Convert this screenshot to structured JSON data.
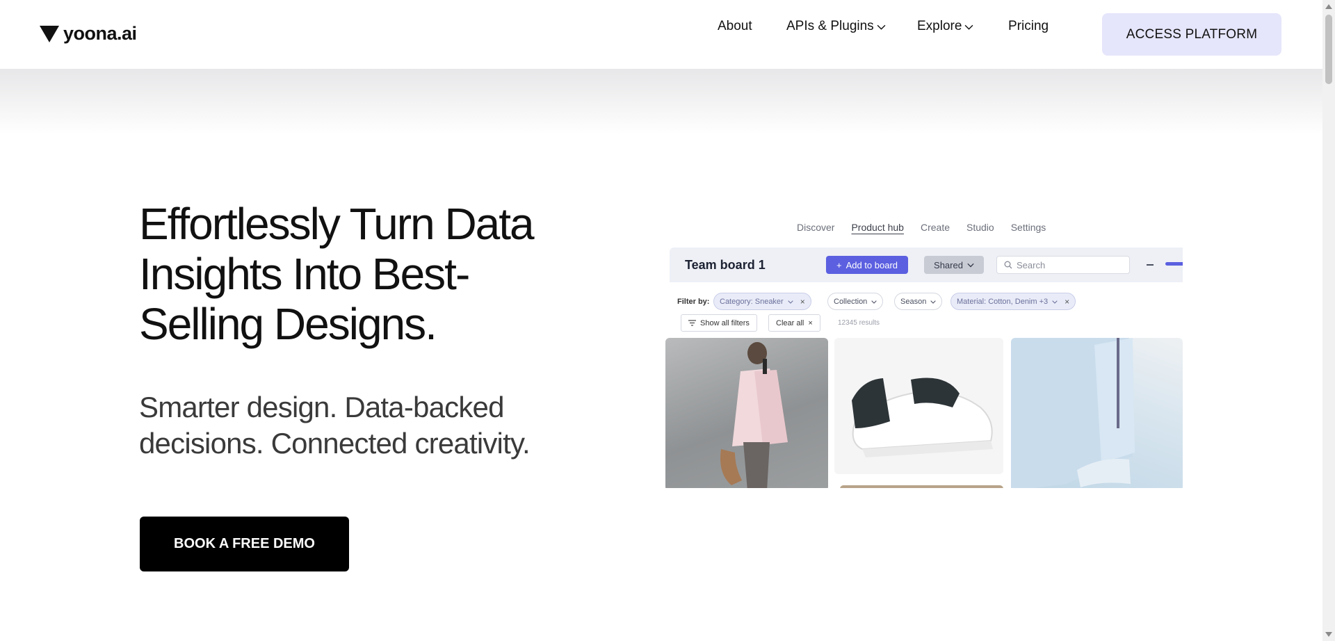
{
  "brand": {
    "name": "yoona.ai"
  },
  "nav": {
    "items": [
      {
        "label": "About"
      },
      {
        "label": "APIs & Plugins"
      },
      {
        "label": "Explore"
      },
      {
        "label": "Pricing"
      }
    ],
    "cta_label": "ACCESS PLATFORM"
  },
  "hero": {
    "headline": "Effortlessly Turn Data Insights Into Best-Selling Designs.",
    "subline": "Smarter design. Data-backed decisions. Connected creativity.",
    "cta_label": "BOOK A FREE DEMO"
  },
  "mockup": {
    "tabs": [
      {
        "label": "Discover"
      },
      {
        "label": "Product hub"
      },
      {
        "label": "Create"
      },
      {
        "label": "Studio"
      },
      {
        "label": "Settings"
      }
    ],
    "board_title": "Team board 1",
    "add_to_board_label": "Add to board",
    "shared_label": "Shared",
    "search_placeholder": "Search",
    "filter_label": "Filter by:",
    "filters": [
      {
        "label": "Category: Sneaker"
      },
      {
        "label": "Collection"
      },
      {
        "label": "Season"
      },
      {
        "label": "Material: Cotton, Denim +3"
      }
    ],
    "show_all_filters_label": "Show all filters",
    "clear_all_label": "Clear all",
    "results_text": "12345 results"
  },
  "colors": {
    "cta_bg": "#000000",
    "platform_btn_bg": "#e5e5fb",
    "accent": "#5b5fe0"
  }
}
